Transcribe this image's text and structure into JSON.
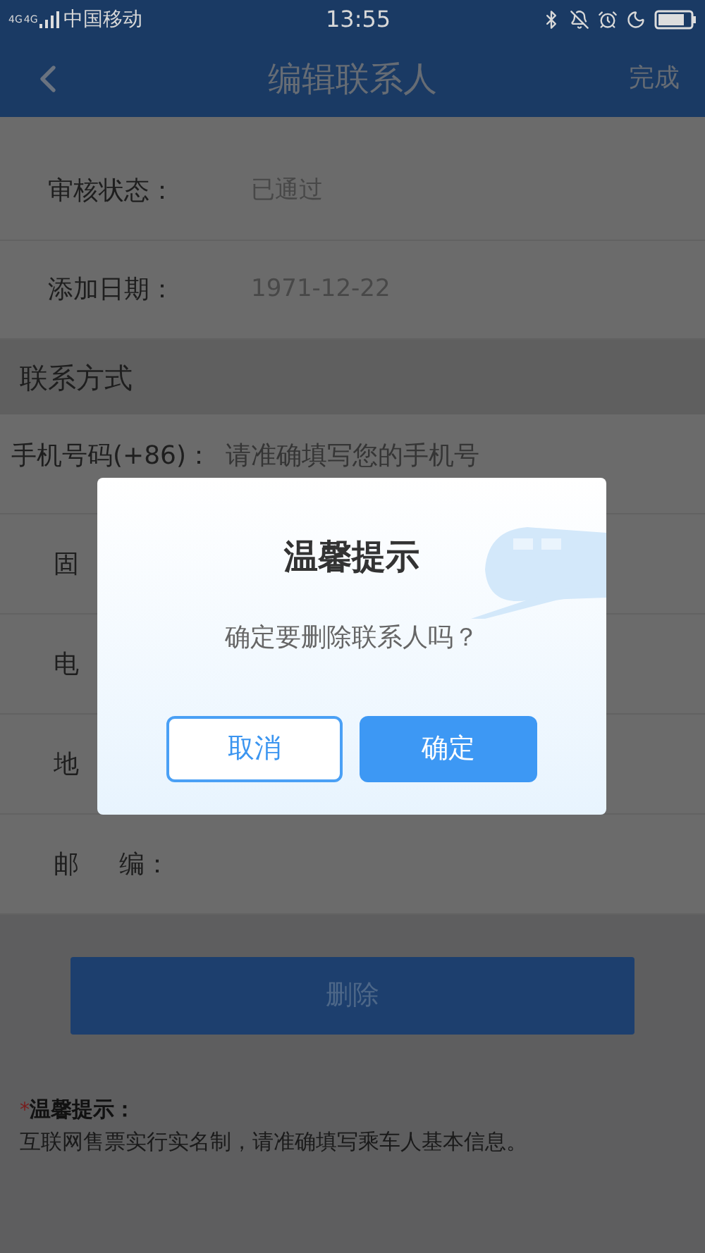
{
  "status_bar": {
    "network": [
      "4G",
      "4G"
    ],
    "carrier": "中国移动",
    "time": "13:55"
  },
  "nav": {
    "title": "编辑联系人",
    "action": "完成"
  },
  "info_rows": [
    {
      "label": "审核状态：",
      "value": "已通过"
    },
    {
      "label": "添加日期：",
      "value": "1971-12-22"
    }
  ],
  "section_title": "联系方式",
  "contact_rows": [
    {
      "label": "手机号码(+86)：",
      "placeholder": "请准确填写您的手机号"
    },
    {
      "label": "固"
    },
    {
      "label": "电"
    },
    {
      "label": "地"
    },
    {
      "label": "邮     编："
    }
  ],
  "delete_button": "删除",
  "tip": {
    "mark": "*",
    "title": "温馨提示：",
    "text": "互联网售票实行实名制，请准确填写乘车人基本信息。"
  },
  "dialog": {
    "title": "温馨提示",
    "message": "确定要删除联系人吗？",
    "cancel": "取消",
    "confirm": "确定"
  }
}
